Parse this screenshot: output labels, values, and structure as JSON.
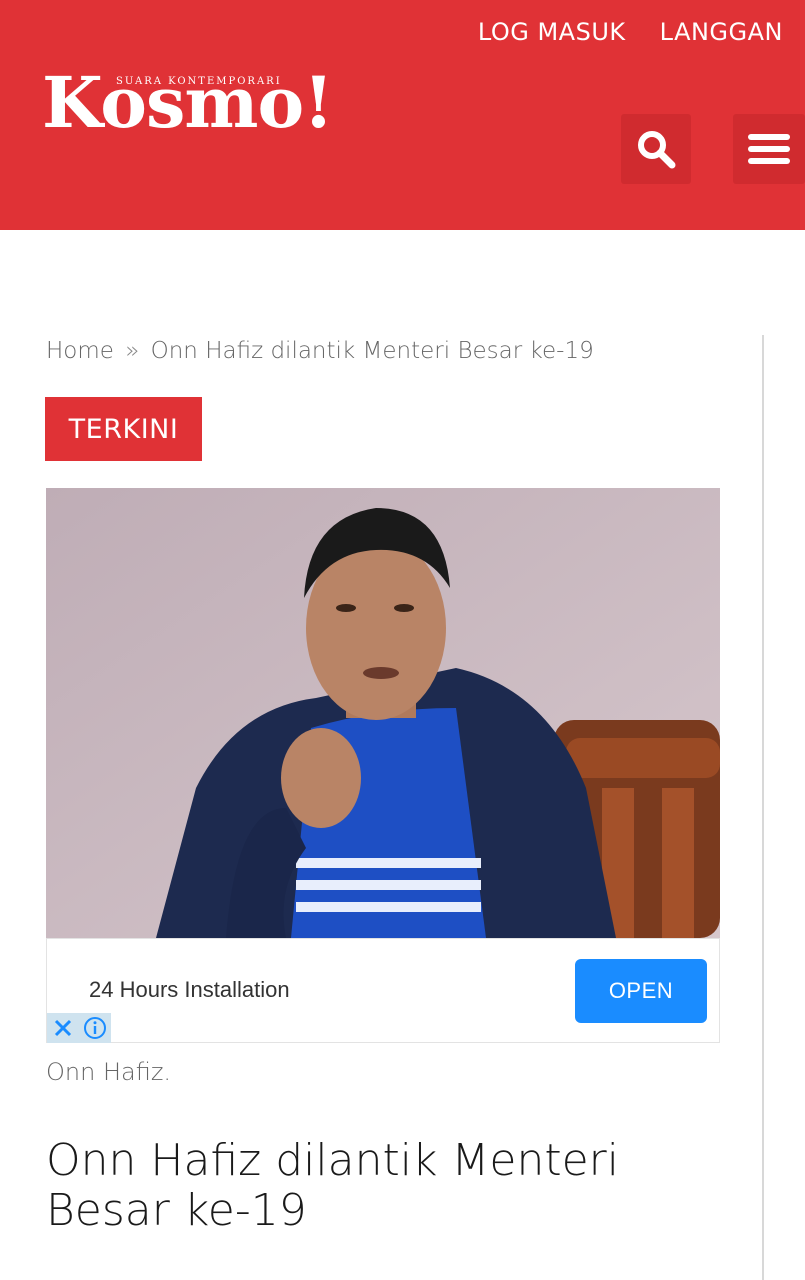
{
  "header": {
    "login_label": "LOG MASUK",
    "subscribe_label": "LANGGAN",
    "logo_word": "Kosmo!",
    "logo_tagline": "SUARA KONTEMPORARI",
    "search_icon": "search-icon",
    "menu_icon": "hamburger-menu-icon",
    "brand_color": "#e03236"
  },
  "breadcrumb": {
    "home": "Home",
    "separator": "»",
    "current": "Onn Hafiz dilantik Menteri Besar ke-19"
  },
  "category_badge": "TERKINI",
  "ad": {
    "text": "24 Hours Installation",
    "button_label": "OPEN",
    "close_icon": "close-icon",
    "info_icon": "info-icon",
    "button_color": "#1a8cff"
  },
  "photo_caption": "Onn Hafiz.",
  "headline": "Onn Hafiz dilantik Menteri Besar ke-19"
}
